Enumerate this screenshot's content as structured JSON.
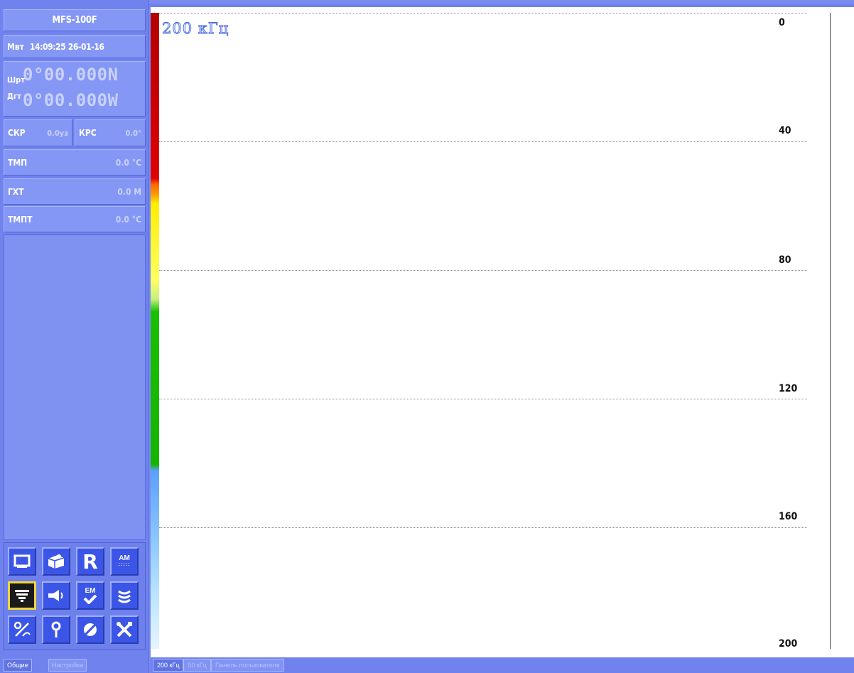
{
  "sidebar": {
    "model": "MFS-100F",
    "time_label": "Мвт",
    "time_value": "14:09:25 26-01-16",
    "lat_label": "Шрт",
    "lat_value": "0°00.000N",
    "lon_label": "Дгт",
    "lon_value": "0°00.000W",
    "speed_label": "СКР",
    "speed_value": "0.0уз",
    "course_label": "КРС",
    "course_value": "0.0°",
    "temp_label": "ТМП",
    "temp_value": "0.0 °C",
    "depth_label": "ГХТ",
    "depth_value": "0.0 М",
    "watertemp_label": "ТМПТ",
    "watertemp_value": "0.0 °C",
    "icon_r": "R",
    "icon_am": "AM",
    "icon_em": "EM",
    "tabs": [
      "Общие",
      "Настройки"
    ]
  },
  "echogram": {
    "freq_label": "200 кГц",
    "depth_ticks": [
      "0",
      "40",
      "80",
      "120",
      "160",
      "200"
    ]
  },
  "bottom_tabs": [
    "200 кГц",
    "50 кГц",
    "Панель пользователя"
  ]
}
